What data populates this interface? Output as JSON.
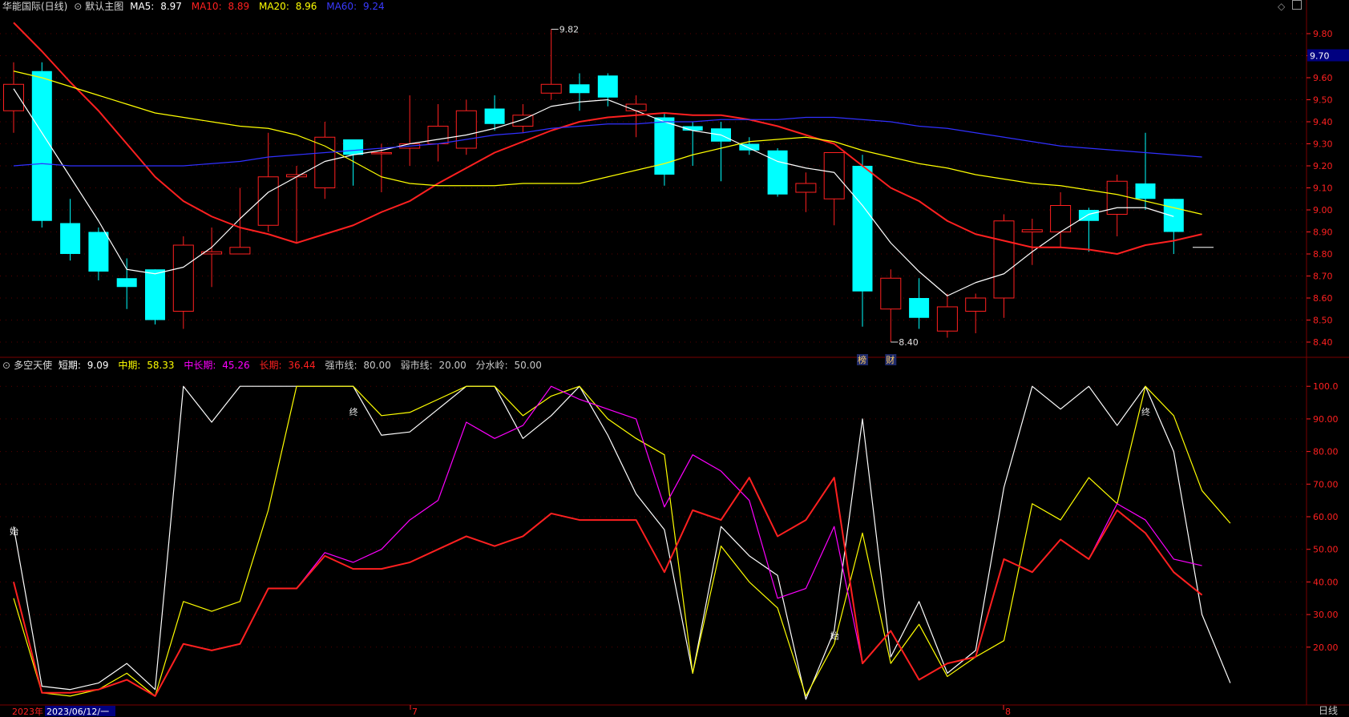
{
  "main_header": {
    "title": "华能国际(日线)",
    "template": "默认主图",
    "ma5_label": "MA5:",
    "ma5_value": "8.97",
    "ma5_color": "#ffffff",
    "ma10_label": "MA10:",
    "ma10_value": "8.89",
    "ma10_color": "#ff2020",
    "ma20_label": "MA20:",
    "ma20_value": "8.96",
    "ma20_color": "#ffff00",
    "ma60_label": "MA60:",
    "ma60_value": "9.24",
    "ma60_color": "#3030ff"
  },
  "sub_header": {
    "title": "多空天使",
    "short_label": "短期:",
    "short_value": "9.09",
    "short_color": "#ffffff",
    "mid_label": "中期:",
    "mid_value": "58.33",
    "mid_color": "#ffff00",
    "midlong_label": "中长期:",
    "midlong_value": "45.26",
    "midlong_color": "#ff00ff",
    "long_label": "长期:",
    "long_value": "36.44",
    "long_color": "#ff2020",
    "strong_label": "强市线:",
    "strong_value": "80.00",
    "weak_label": "弱市线:",
    "weak_value": "20.00",
    "water_label": "分水岭:",
    "water_value": "50.00"
  },
  "bottom_bar": {
    "year_label": "2023年",
    "date_label": "2023/06/12/一",
    "month_labels": [
      "7",
      "8"
    ],
    "period_label": "日线"
  },
  "current_price_tag": "9.70",
  "chart_data": [
    {
      "type": "candlestick",
      "title": "华能国际(日线)",
      "ylim": [
        8.36,
        9.88
      ],
      "y_ticks": [
        "9.80",
        "9.70",
        "9.60",
        "9.50",
        "9.40",
        "9.30",
        "9.20",
        "9.10",
        "9.00",
        "8.90",
        "8.80",
        "8.70",
        "8.60",
        "8.50",
        "8.40"
      ],
      "candles": [
        {
          "o": 9.45,
          "h": 9.67,
          "l": 9.35,
          "c": 9.57
        },
        {
          "o": 9.63,
          "h": 9.67,
          "l": 8.92,
          "c": 8.95
        },
        {
          "o": 8.94,
          "h": 9.05,
          "l": 8.77,
          "c": 8.8
        },
        {
          "o": 8.9,
          "h": 8.92,
          "l": 8.68,
          "c": 8.72
        },
        {
          "o": 8.69,
          "h": 8.78,
          "l": 8.55,
          "c": 8.65
        },
        {
          "o": 8.73,
          "h": 8.73,
          "l": 8.48,
          "c": 8.5
        },
        {
          "o": 8.54,
          "h": 8.88,
          "l": 8.46,
          "c": 8.84
        },
        {
          "o": 8.8,
          "h": 8.92,
          "l": 8.65,
          "c": 8.81
        },
        {
          "o": 8.8,
          "h": 9.1,
          "l": 8.8,
          "c": 8.83
        },
        {
          "o": 8.93,
          "h": 9.35,
          "l": 8.9,
          "c": 9.15
        },
        {
          "o": 9.15,
          "h": 9.2,
          "l": 8.85,
          "c": 9.16
        },
        {
          "o": 9.1,
          "h": 9.4,
          "l": 9.05,
          "c": 9.33
        },
        {
          "o": 9.32,
          "h": 9.32,
          "l": 9.11,
          "c": 9.25
        },
        {
          "o": 9.26,
          "h": 9.3,
          "l": 9.08,
          "c": 9.26
        },
        {
          "o": 9.28,
          "h": 9.52,
          "l": 9.2,
          "c": 9.3
        },
        {
          "o": 9.3,
          "h": 9.48,
          "l": 9.22,
          "c": 9.38
        },
        {
          "o": 9.28,
          "h": 9.5,
          "l": 9.25,
          "c": 9.45
        },
        {
          "o": 9.46,
          "h": 9.52,
          "l": 9.36,
          "c": 9.39
        },
        {
          "o": 9.38,
          "h": 9.48,
          "l": 9.35,
          "c": 9.43
        },
        {
          "o": 9.53,
          "h": 9.82,
          "l": 9.5,
          "c": 9.57
        },
        {
          "o": 9.57,
          "h": 9.62,
          "l": 9.45,
          "c": 9.53
        },
        {
          "o": 9.61,
          "h": 9.62,
          "l": 9.47,
          "c": 9.51
        },
        {
          "o": 9.45,
          "h": 9.52,
          "l": 9.33,
          "c": 9.48
        },
        {
          "o": 9.42,
          "h": 9.44,
          "l": 9.11,
          "c": 9.16
        },
        {
          "o": 9.38,
          "h": 9.4,
          "l": 9.2,
          "c": 9.36
        },
        {
          "o": 9.37,
          "h": 9.4,
          "l": 9.13,
          "c": 9.31
        },
        {
          "o": 9.3,
          "h": 9.33,
          "l": 9.25,
          "c": 9.27
        },
        {
          "o": 9.27,
          "h": 9.28,
          "l": 9.06,
          "c": 9.07
        },
        {
          "o": 9.08,
          "h": 9.17,
          "l": 8.99,
          "c": 9.12
        },
        {
          "o": 9.05,
          "h": 9.26,
          "l": 8.93,
          "c": 9.26
        },
        {
          "o": 9.2,
          "h": 9.25,
          "l": 8.47,
          "c": 8.63
        },
        {
          "o": 8.55,
          "h": 8.73,
          "l": 8.4,
          "c": 8.69
        },
        {
          "o": 8.6,
          "h": 8.69,
          "l": 8.46,
          "c": 8.51
        },
        {
          "o": 8.45,
          "h": 8.62,
          "l": 8.42,
          "c": 8.56
        },
        {
          "o": 8.54,
          "h": 8.62,
          "l": 8.44,
          "c": 8.6
        },
        {
          "o": 8.6,
          "h": 8.98,
          "l": 8.51,
          "c": 8.95
        },
        {
          "o": 8.9,
          "h": 8.96,
          "l": 8.75,
          "c": 8.91
        },
        {
          "o": 8.9,
          "h": 9.08,
          "l": 8.83,
          "c": 9.02
        },
        {
          "o": 9.0,
          "h": 9.01,
          "l": 8.81,
          "c": 8.95
        },
        {
          "o": 8.98,
          "h": 9.16,
          "l": 8.88,
          "c": 9.13
        },
        {
          "o": 9.12,
          "h": 9.35,
          "l": 9.0,
          "c": 9.05
        },
        {
          "o": 9.05,
          "h": 9.05,
          "l": 8.8,
          "c": 8.9
        }
      ],
      "series": [
        {
          "name": "MA5",
          "color": "#ffffff",
          "values": [
            9.55,
            9.35,
            9.15,
            8.95,
            8.73,
            8.71,
            8.74,
            8.83,
            8.96,
            9.08,
            9.15,
            9.22,
            9.25,
            9.27,
            9.3,
            9.32,
            9.34,
            9.37,
            9.41,
            9.47,
            9.49,
            9.5,
            9.45,
            9.4,
            9.36,
            9.34,
            9.28,
            9.22,
            9.19,
            9.17,
            9.02,
            8.85,
            8.72,
            8.61,
            8.67,
            8.71,
            8.81,
            8.9,
            8.98,
            9.01,
            9.01,
            8.97
          ]
        },
        {
          "name": "MA10",
          "color": "#ff2020",
          "values": [
            9.85,
            9.72,
            9.58,
            9.45,
            9.3,
            9.15,
            9.04,
            8.97,
            8.92,
            8.89,
            8.85,
            8.89,
            8.93,
            8.99,
            9.04,
            9.12,
            9.19,
            9.26,
            9.31,
            9.36,
            9.4,
            9.42,
            9.43,
            9.44,
            9.43,
            9.43,
            9.41,
            9.38,
            9.34,
            9.3,
            9.2,
            9.1,
            9.04,
            8.95,
            8.89,
            8.86,
            8.83,
            8.83,
            8.82,
            8.8,
            8.84,
            8.86,
            8.89
          ]
        },
        {
          "name": "MA20",
          "color": "#ffff00",
          "values": [
            9.63,
            9.6,
            9.56,
            9.52,
            9.48,
            9.44,
            9.42,
            9.4,
            9.38,
            9.37,
            9.34,
            9.29,
            9.22,
            9.15,
            9.12,
            9.11,
            9.11,
            9.11,
            9.12,
            9.12,
            9.12,
            9.15,
            9.18,
            9.21,
            9.25,
            9.28,
            9.31,
            9.32,
            9.33,
            9.31,
            9.27,
            9.24,
            9.21,
            9.19,
            9.16,
            9.14,
            9.12,
            9.11,
            9.09,
            9.07,
            9.04,
            9.01,
            8.98
          ]
        },
        {
          "name": "MA60",
          "color": "#3030ff",
          "values": [
            9.2,
            9.21,
            9.2,
            9.2,
            9.2,
            9.2,
            9.2,
            9.21,
            9.22,
            9.24,
            9.25,
            9.26,
            9.27,
            9.28,
            9.29,
            9.3,
            9.32,
            9.34,
            9.35,
            9.37,
            9.38,
            9.39,
            9.39,
            9.4,
            9.4,
            9.41,
            9.41,
            9.41,
            9.42,
            9.42,
            9.41,
            9.4,
            9.38,
            9.37,
            9.35,
            9.33,
            9.31,
            9.29,
            9.28,
            9.27,
            9.26,
            9.25,
            9.24
          ]
        }
      ],
      "annotations": [
        {
          "text": "9.82",
          "index": 19,
          "value": 9.82
        },
        {
          "text": "8.40",
          "index": 31,
          "value": 8.4
        },
        {
          "text": "榜",
          "index": 30
        },
        {
          "text": "财",
          "index": 31
        }
      ]
    },
    {
      "type": "line",
      "title": "多空天使",
      "ylim": [
        3,
        103
      ],
      "y_ticks": [
        "100.0",
        "90.00",
        "80.00",
        "70.00",
        "60.00",
        "50.00",
        "40.00",
        "30.00",
        "20.00"
      ],
      "series": [
        {
          "name": "短期",
          "color": "#ffffff",
          "values": [
            57,
            8,
            7,
            9,
            15,
            7,
            100,
            89,
            100,
            100,
            100,
            100,
            100,
            85,
            86,
            93,
            100,
            100,
            84,
            91,
            100,
            85,
            67,
            56,
            12,
            57,
            48,
            42,
            4,
            25,
            90,
            17,
            34,
            12,
            19,
            69,
            100,
            93,
            100,
            88,
            100,
            80,
            30,
            9
          ]
        },
        {
          "name": "中期",
          "color": "#ffff00",
          "values": [
            35,
            6,
            5,
            7,
            12,
            5,
            34,
            31,
            34,
            62,
            100,
            100,
            100,
            91,
            92,
            96,
            100,
            100,
            91,
            97,
            100,
            90,
            84,
            79,
            12,
            51,
            40,
            32,
            5,
            21,
            55,
            15,
            27,
            11,
            17,
            22,
            64,
            59,
            72,
            64,
            100,
            91,
            68,
            58
          ]
        },
        {
          "name": "中长期",
          "color": "#ff00ff",
          "values": [
            40,
            6,
            6,
            7,
            10,
            5,
            21,
            19,
            21,
            38,
            38,
            49,
            46,
            50,
            59,
            65,
            89,
            84,
            88,
            100,
            96,
            93,
            90,
            63,
            79,
            74,
            65,
            35,
            38,
            57,
            15,
            25,
            10,
            15,
            17,
            47,
            43,
            53,
            47,
            64,
            59,
            47,
            45
          ]
        },
        {
          "name": "长期",
          "color": "#ff2020",
          "values": [
            40,
            6,
            6,
            7,
            10,
            5,
            21,
            19,
            21,
            38,
            38,
            48,
            44,
            44,
            46,
            50,
            54,
            51,
            54,
            61,
            59,
            59,
            59,
            43,
            62,
            59,
            72,
            54,
            59,
            72,
            15,
            25,
            10,
            15,
            17,
            47,
            43,
            53,
            47,
            62,
            55,
            43,
            36
          ]
        }
      ],
      "annotations": [
        {
          "text": "始",
          "index": 0
        },
        {
          "text": "终",
          "index": 12
        },
        {
          "text": "始",
          "index": 29
        },
        {
          "text": "终",
          "index": 40
        }
      ]
    }
  ]
}
